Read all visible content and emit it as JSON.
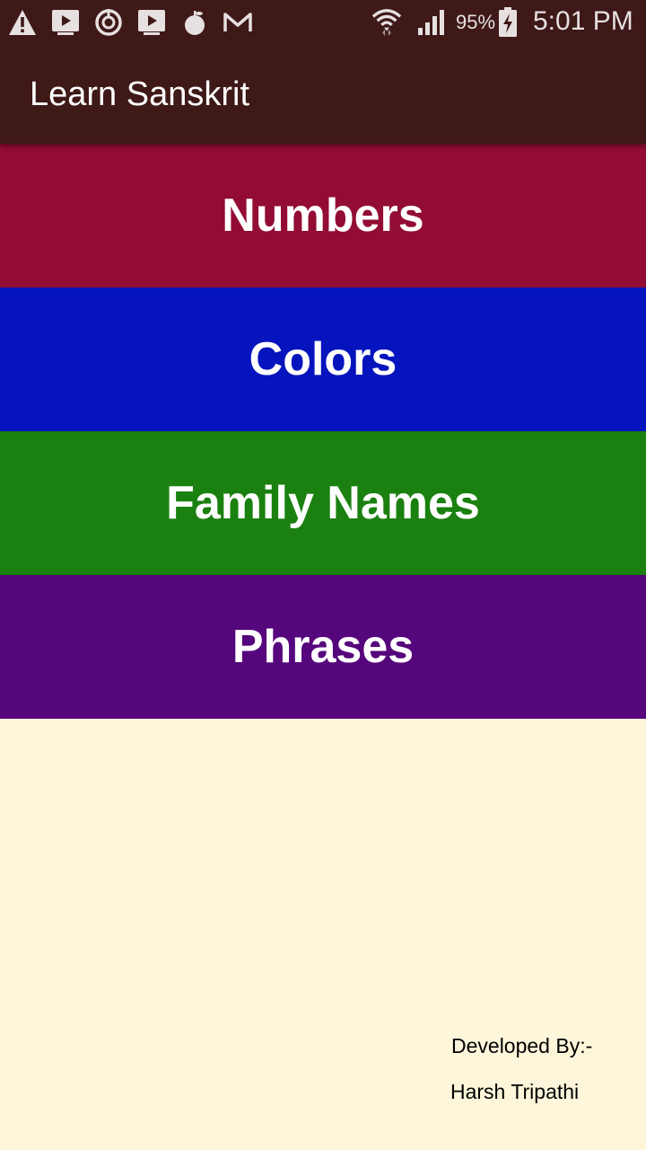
{
  "status_bar": {
    "icons": [
      "warning-icon",
      "video-icon",
      "sync-icon",
      "tv-icon",
      "fruit-icon",
      "gmail-icon",
      "wifi-icon",
      "signal-icon",
      "battery-icon"
    ],
    "battery_percent": "95%",
    "time": "5:01 PM",
    "background": "#3F1818"
  },
  "app_bar": {
    "title": "Learn Sanskrit",
    "background": "#3F1818"
  },
  "categories": [
    {
      "label": "Numbers",
      "color": "#920C33"
    },
    {
      "label": "Colors",
      "color": "#0514BC"
    },
    {
      "label": "Family Names",
      "color": "#1A800F"
    },
    {
      "label": "Phrases",
      "color": "#56067C"
    }
  ],
  "footer": {
    "developed_by": "Developed By:-",
    "developer_name": "Harsh Tripathi"
  },
  "page_background": "#FDF6DB"
}
